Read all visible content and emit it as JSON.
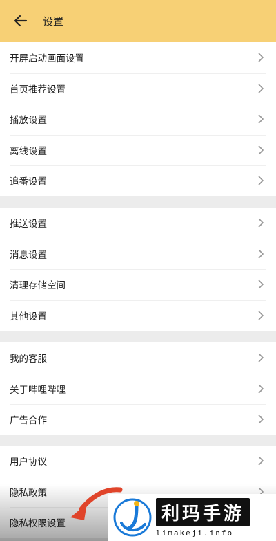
{
  "header": {
    "title": "设置",
    "back_icon": "arrow-left-icon"
  },
  "groups": [
    {
      "items": [
        "开屏启动画面设置",
        "首页推荐设置",
        "播放设置",
        "离线设置",
        "追番设置"
      ]
    },
    {
      "items": [
        "推送设置",
        "消息设置",
        "清理存储空间",
        "其他设置"
      ]
    },
    {
      "items": [
        "我的客服",
        "关于哔哩哔哩",
        "广告合作"
      ]
    },
    {
      "items": [
        "用户协议",
        "隐私政策",
        "隐私权限设置"
      ]
    }
  ],
  "watermark": {
    "name": "利玛手游",
    "url": "limakeji.info"
  },
  "colors": {
    "header_bg": "#f7d075",
    "page_bg": "#ececec",
    "arrow": "#e0442a"
  }
}
